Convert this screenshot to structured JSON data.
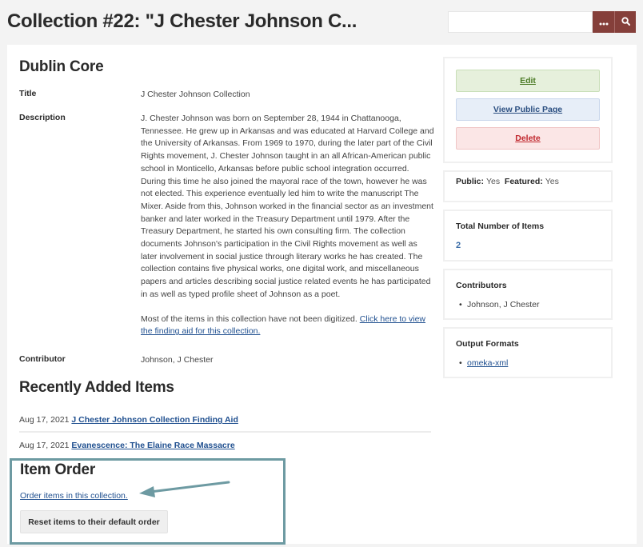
{
  "header": {
    "page_title": "Collection #22: \"J Chester Johnson C...",
    "search": {
      "value": "",
      "placeholder": ""
    },
    "advanced_search_icon": "ellipsis-icon",
    "search_icon": "magnifier-icon"
  },
  "dublin_core": {
    "heading": "Dublin Core",
    "fields": {
      "title": {
        "label": "Title",
        "value": "J Chester Johnson Collection"
      },
      "description": {
        "label": "Description",
        "paragraph1": "J. Chester Johnson was born on September 28, 1944 in Chattanooga, Tennessee. He grew up in Arkansas and was educated at Harvard College and the University of Arkansas. From 1969 to 1970, during the later part of the Civil Rights movement, J. Chester Johnson taught in an all African-American public school in Monticello, Arkansas before public school integration occurred. During this time he also joined the mayoral race of the town, however he was not elected. This experience eventually led him to write the manuscript The Mixer. Aside from this, Johnson worked in the financial sector as an investment banker and later worked in the Treasury Department until 1979. After the Treasury Department, he started his own consulting firm. The collection documents Johnson's participation in the Civil Rights movement as well as later involvement in social justice through literary works he has created. The collection contains five physical works, one digital work, and miscellaneous papers and articles describing social justice related events he has participated in as well as typed profile sheet of Johnson as a poet.",
        "paragraph2_text": "Most of the items in this collection have not been digitized. ",
        "paragraph2_link": "Click here to view the finding aid for this collection."
      },
      "contributor": {
        "label": "Contributor",
        "value": "Johnson, J Chester"
      }
    }
  },
  "recent_items": {
    "heading": "Recently Added Items",
    "items": [
      {
        "date": "Aug 17, 2021",
        "title": "J Chester Johnson Collection Finding Aid"
      },
      {
        "date": "Aug 17, 2021",
        "title": "Evanescence: The Elaine Race Massacre"
      }
    ]
  },
  "item_order": {
    "heading": "Item Order",
    "order_link": "Order items in this collection.",
    "reset_button": "Reset items to their default order",
    "annotation_color": "#6d9aa2"
  },
  "sidebar": {
    "actions": {
      "edit": "Edit",
      "view_public": "View Public Page",
      "delete": "Delete"
    },
    "status": {
      "public_label": "Public:",
      "public_value": "Yes",
      "featured_label": "Featured:",
      "featured_value": "Yes"
    },
    "total_items": {
      "heading": "Total Number of Items",
      "value": "2"
    },
    "contributors": {
      "heading": "Contributors",
      "items": [
        "Johnson, J Chester"
      ]
    },
    "output_formats": {
      "heading": "Output Formats",
      "items": [
        "omeka-xml"
      ]
    }
  },
  "colors": {
    "brand": "#853f3a",
    "link": "#1f4f8f",
    "edit_green": "#4a7a24",
    "view_blue": "#2a4e80",
    "delete_red": "#c0272d"
  }
}
